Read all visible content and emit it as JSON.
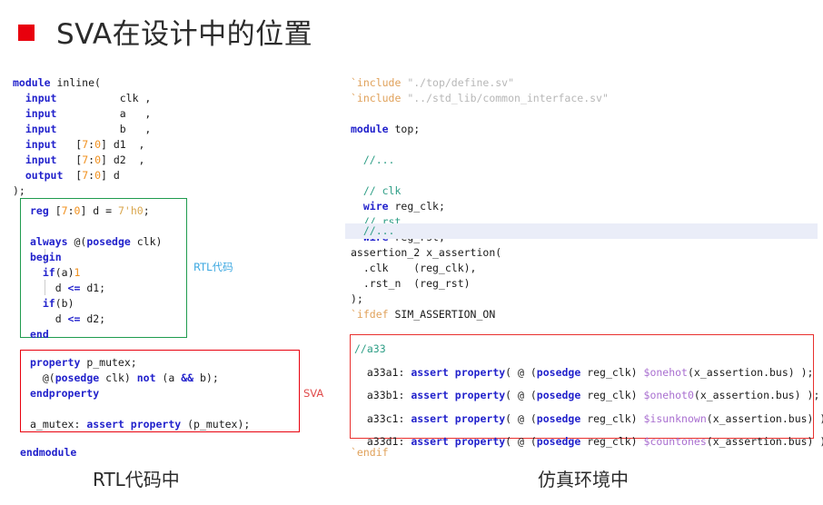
{
  "slide": {
    "title": "SVA在设计中的位置",
    "bullet_color": "#e8000d"
  },
  "left_panel": {
    "header_code": "module inline(\n  input          clk ,\n  input          a   ,\n  input          b   ,\n  input   [7:0] d1  ,\n  input   [7:0] d2  ,\n  output  [7:0] d\n);",
    "rtl_box": {
      "border_color": "#1f9b4e",
      "code": "reg [7:0] d = 7'h0;\n\nalways @(posedge clk)\nbegin\n  if(a)1\n    d <= d1;\n  if(b)\n    d <= d2;\nend"
    },
    "rtl_label": "RTL代码",
    "rtl_label_color": "#3ba7e0",
    "sva_box": {
      "border_color": "#e8000d",
      "code": "property p_mutex;\n  @(posedge clk) not (a && b);\nendproperty\n\na_mutex: assert property (p_mutex);"
    },
    "sva_label": "SVA",
    "sva_label_color": "#e04a4a",
    "endmodule": "endmodule",
    "caption": "RTL代码中"
  },
  "right_panel": {
    "header_code": "`include \"./top/define.sv\"\n`include \"../std_lib/common_interface.sv\"\n\nmodule top;\n\n  //...\n\n  // clk\n  wire reg_clk;\n  // rst\n  wire reg_rst;",
    "highlight_line": "  //...",
    "highlight_color": "#eaedf8",
    "mid_code": "assertion_2 x_assertion(\n  .clk    (reg_clk),\n  .rst_n  (reg_rst)\n);\n`ifdef SIM_ASSERTION_ON",
    "assert_box": {
      "border_color": "#e8302e",
      "comment": "//a33",
      "assertions": [
        {
          "label": "a33a1:",
          "keyword": "assert property(",
          "clock": "@ (posedge reg_clk)",
          "sysfunc": "$onehot",
          "arg": "(x_assertion.bus) );"
        },
        {
          "label": "a33b1:",
          "keyword": "assert property(",
          "clock": "@ (posedge reg_clk)",
          "sysfunc": "$onehot0",
          "arg": "(x_assertion.bus) );"
        },
        {
          "label": "a33c1:",
          "keyword": "assert property(",
          "clock": "@ (posedge reg_clk)",
          "sysfunc": "$isunknown",
          "arg": "(x_assertion.bus) );"
        },
        {
          "label": "a33d1:",
          "keyword": "assert property(",
          "clock": "@ (posedge reg_clk)",
          "sysfunc": "$countones",
          "arg": "(x_assertion.bus) );"
        }
      ]
    },
    "endif": "`endif",
    "caption": "仿真环境中"
  }
}
